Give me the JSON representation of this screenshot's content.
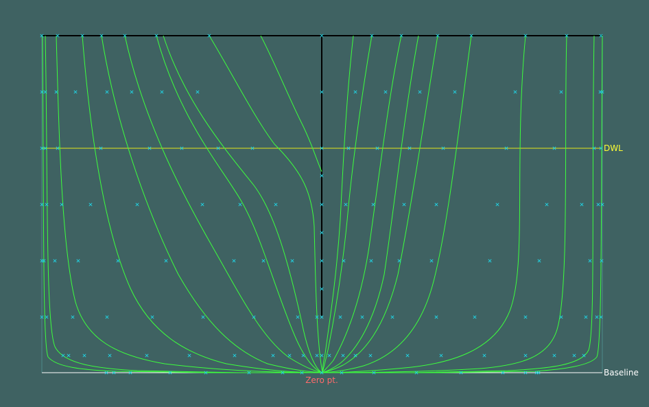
{
  "labels": {
    "dwl": "DWL",
    "baseline": "Baseline",
    "zero_point": "Zero pt."
  },
  "colors": {
    "background": "#3f6262",
    "station_curve": "#3dff3d",
    "dwl_line": "#e6e619",
    "dwl_text": "#ffff33",
    "baseline_line": "#ffffff",
    "baseline_text": "#ffffff",
    "zero_text": "#ff6b6b",
    "frame_line": "#000000",
    "marker": "#22d0e0"
  },
  "icons": {
    "control_point": "x-marker"
  }
}
